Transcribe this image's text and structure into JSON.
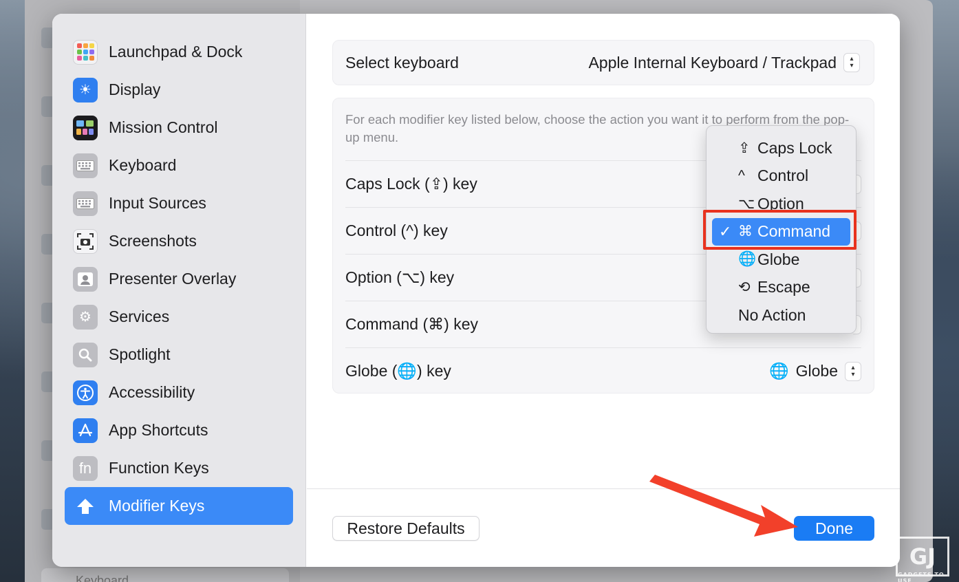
{
  "sidebar": {
    "items": [
      {
        "label": "Launchpad & Dock",
        "icon": "launchpad-icon"
      },
      {
        "label": "Display",
        "icon": "sun-icon"
      },
      {
        "label": "Mission Control",
        "icon": "mission-control-icon"
      },
      {
        "label": "Keyboard",
        "icon": "keyboard-icon"
      },
      {
        "label": "Input Sources",
        "icon": "keyboard-icon"
      },
      {
        "label": "Screenshots",
        "icon": "camera-icon"
      },
      {
        "label": "Presenter Overlay",
        "icon": "person-icon"
      },
      {
        "label": "Services",
        "icon": "gears-icon"
      },
      {
        "label": "Spotlight",
        "icon": "magnifier-icon"
      },
      {
        "label": "Accessibility",
        "icon": "accessibility-icon"
      },
      {
        "label": "App Shortcuts",
        "icon": "app-store-icon"
      },
      {
        "label": "Function Keys",
        "icon": "fn-icon"
      },
      {
        "label": "Modifier Keys",
        "icon": "modifier-arrow-icon",
        "selected": true
      }
    ],
    "fn_glyph": "fn"
  },
  "keyboard_select": {
    "label": "Select keyboard",
    "value": "Apple Internal Keyboard / Trackpad"
  },
  "description": "For each modifier key listed below, choose the action you want it to perform from the pop-up menu.",
  "modifier_rows": [
    {
      "label": "Caps Lock (⇪) key"
    },
    {
      "label": "Control (^) key"
    },
    {
      "label": "Option (⌥) key"
    },
    {
      "label": "Command (⌘) key"
    },
    {
      "label": "Globe (🌐) key",
      "value": "Globe",
      "value_glyph": "🌐"
    }
  ],
  "popup_menu": {
    "items": [
      {
        "glyph": "⇪",
        "label": "Caps Lock"
      },
      {
        "glyph": "^",
        "label": "Control"
      },
      {
        "glyph": "⌥",
        "label": "Option"
      },
      {
        "glyph": "⌘",
        "label": "Command",
        "selected": true
      },
      {
        "glyph": "🌐",
        "label": "Globe"
      },
      {
        "glyph": "⟲",
        "label": "Escape"
      },
      {
        "glyph": "",
        "label": "No Action"
      }
    ],
    "check_glyph": "✓"
  },
  "buttons": {
    "restore_defaults": "Restore Defaults",
    "done": "Done"
  },
  "backdrop": {
    "keyboard_label": "Keyboard"
  },
  "watermark": {
    "logo": "GJ",
    "caption": "GADGETS TO USE"
  },
  "colors": {
    "accent": "#3b8af7",
    "done_button": "#1a7cf4",
    "annotation_red": "#e8321e"
  }
}
